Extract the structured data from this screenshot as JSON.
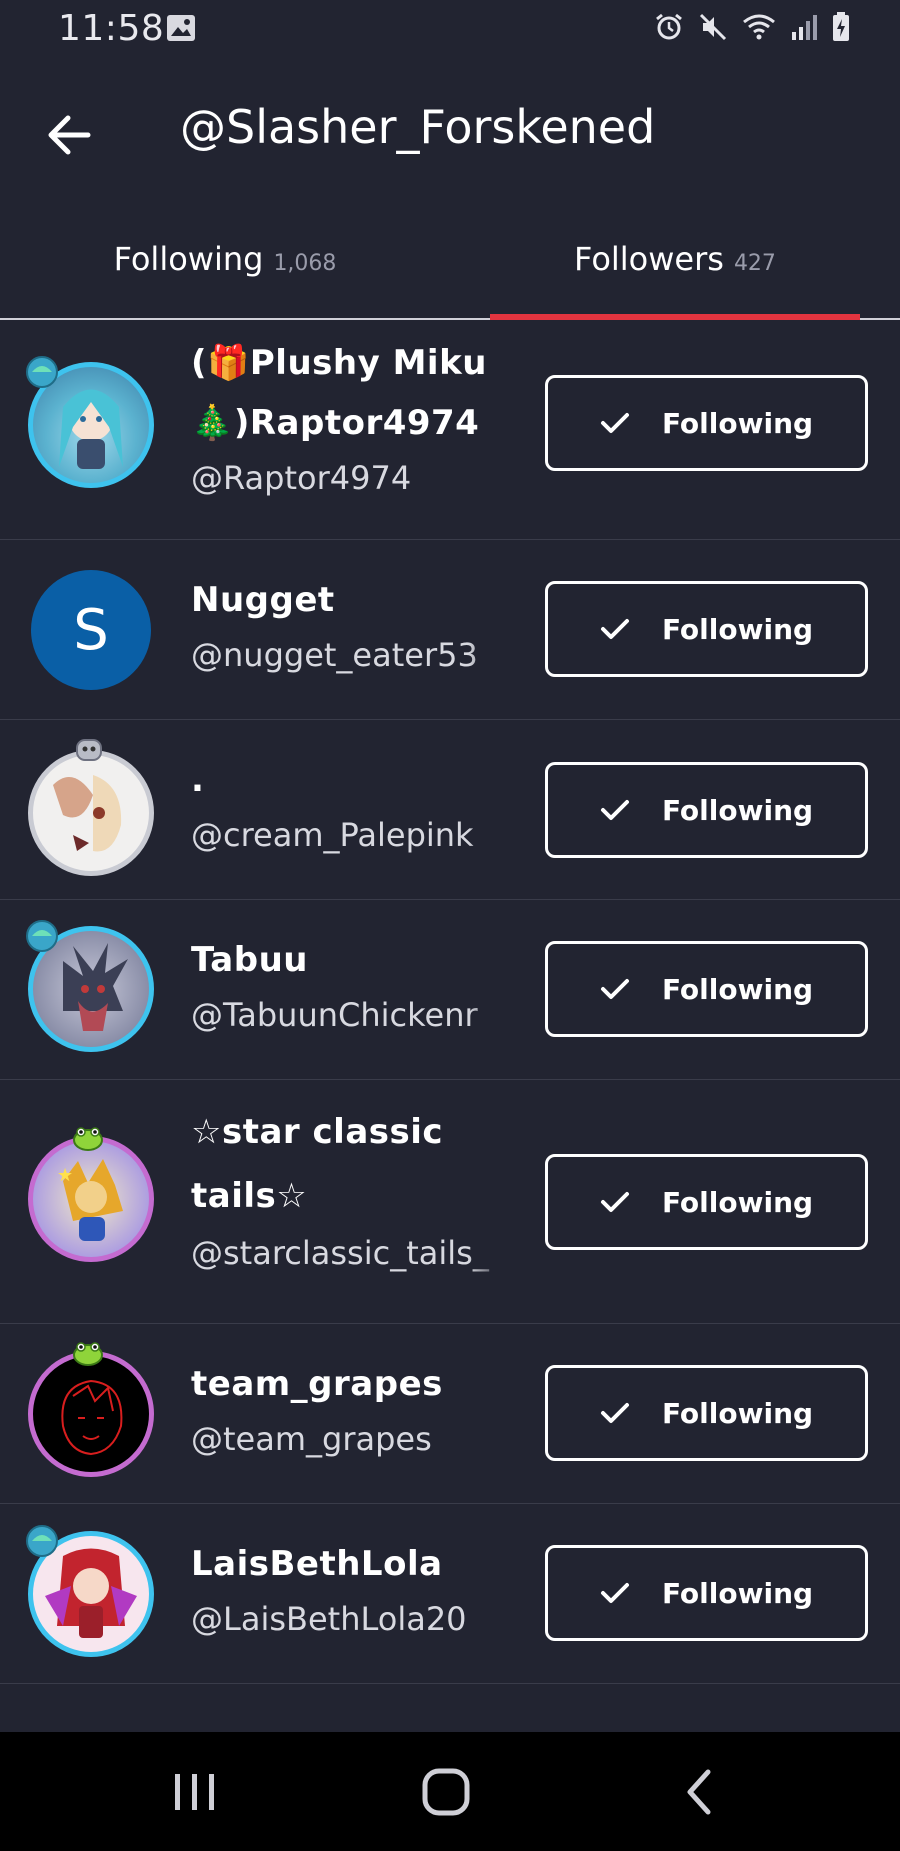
{
  "status_bar": {
    "time": "11:58",
    "icons": [
      "gallery-icon",
      "alarm-icon",
      "mute-icon",
      "wifi-icon",
      "signal-icon",
      "battery-charging-icon"
    ]
  },
  "header": {
    "title": "@Slasher_Forskened",
    "back_icon": "arrow-left-icon"
  },
  "tabs": [
    {
      "label": "Following",
      "count": "1,068",
      "active": false
    },
    {
      "label": "Followers",
      "count": "427",
      "active": true
    }
  ],
  "accent_color": "#e3343f",
  "background_color": "#222431",
  "users": [
    {
      "name": "(🎁Plushy Miku 🎄)Raptor4974",
      "handle": "@Raptor4974",
      "button": "Following"
    },
    {
      "name": "Nugget",
      "handle": "@nugget_eater53",
      "avatar_letter": "S",
      "button": "Following"
    },
    {
      "name": ".",
      "handle": "@cream_Palepink",
      "button": "Following"
    },
    {
      "name": "Tabuu",
      "handle": "@TabuunChickenr",
      "button": "Following"
    },
    {
      "name": "☆star classic tails☆",
      "handle": "@starclassic_tails_",
      "button": "Following"
    },
    {
      "name": "team_grapes",
      "handle": "@team_grapes",
      "button": "Following"
    },
    {
      "name": "LaisBethLola",
      "handle": "@LaisBethLola20",
      "button": "Following"
    }
  ],
  "nav_bar": {
    "icons": [
      "recent-apps-icon",
      "home-icon",
      "back-icon"
    ]
  }
}
